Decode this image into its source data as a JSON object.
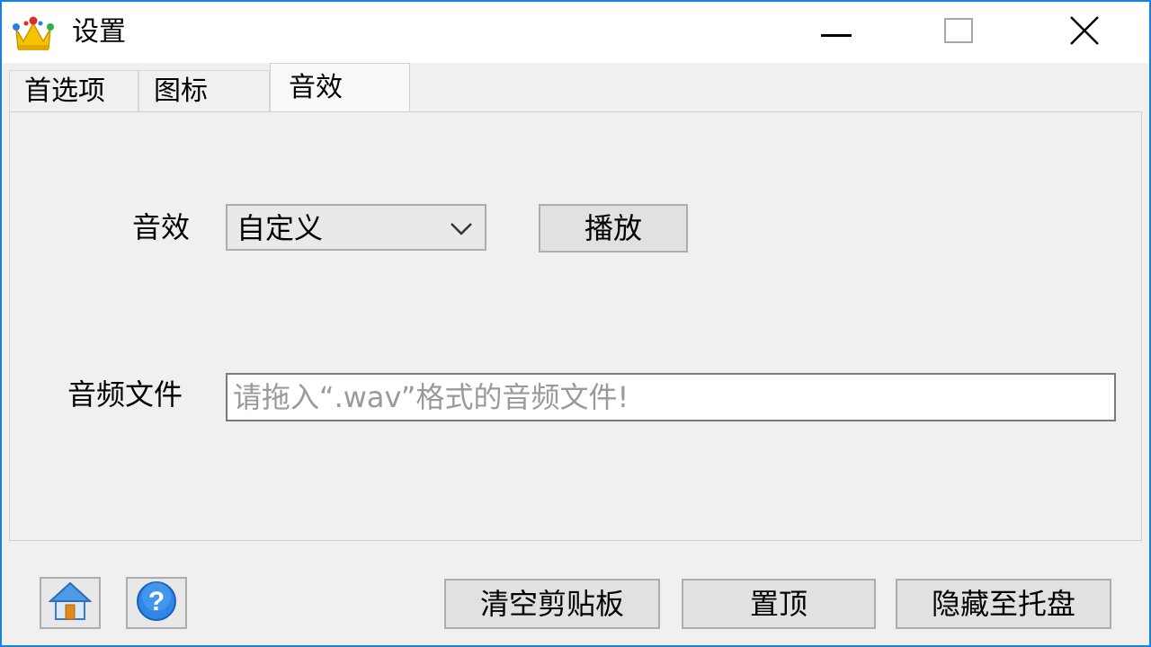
{
  "window": {
    "title": "设置",
    "app_icon": "crown-icon",
    "controls": {
      "minimize": "minimize-icon",
      "maximize": "maximize-icon",
      "close": "close-icon"
    }
  },
  "tabs": [
    {
      "label": "首选项",
      "active": false
    },
    {
      "label": "图标",
      "active": false
    },
    {
      "label": "音效",
      "active": true
    }
  ],
  "sound_tab": {
    "sound_label": "音效",
    "sound_value": "自定义",
    "play_button": "播放",
    "audio_file_label": "音频文件",
    "audio_file_placeholder": "请拖入“.wav”格式的音频文件!",
    "audio_file_value": ""
  },
  "footer": {
    "home_icon": "home-icon",
    "help_icon": "help-icon",
    "clear_clipboard": "清空剪贴板",
    "pin_top": "置顶",
    "hide_to_tray": "隐藏至托盘"
  },
  "colors": {
    "window_border": "#1883d7",
    "background": "#f0f0f0",
    "button_face": "#e1e1e1"
  }
}
